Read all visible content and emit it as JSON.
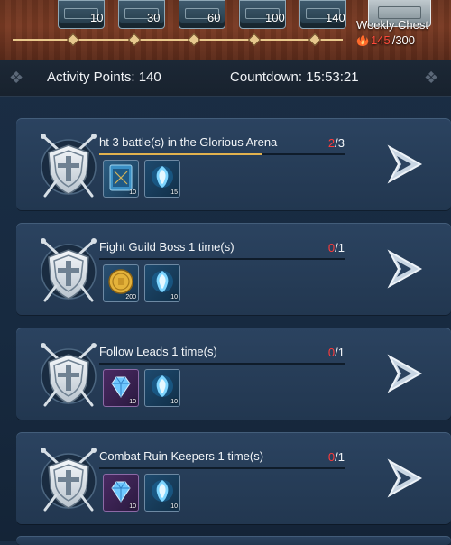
{
  "weekly_chest": {
    "label": "Weekly Chest",
    "current": "145",
    "max": "/300",
    "milestones": [
      "10",
      "30",
      "60",
      "100",
      "140"
    ]
  },
  "stats": {
    "activity_label": "Activity Points: 140",
    "countdown_label": "Countdown: 15:53:21"
  },
  "tasks": [
    {
      "title": "ht 3 battle(s) in the Glorious Arena",
      "progress_current": "2",
      "progress_total": "/3",
      "progress_fraction": 0.667,
      "rewards": [
        {
          "icon": "book-icon",
          "qty": "10"
        },
        {
          "icon": "spirit-orb-icon",
          "qty": "15"
        }
      ]
    },
    {
      "title": "Fight Guild Boss 1 time(s)",
      "progress_current": "0",
      "progress_total": "/1",
      "progress_fraction": 0,
      "rewards": [
        {
          "icon": "gold-coin-icon",
          "qty": "200"
        },
        {
          "icon": "spirit-orb-icon",
          "qty": "10"
        }
      ]
    },
    {
      "title": "Follow Leads 1 time(s)",
      "progress_current": "0",
      "progress_total": "/1",
      "progress_fraction": 0,
      "rewards": [
        {
          "icon": "diamond-icon",
          "qty": "10"
        },
        {
          "icon": "spirit-orb-icon",
          "qty": "10"
        }
      ]
    },
    {
      "title": "Combat Ruin Keepers 1 time(s)",
      "progress_current": "0",
      "progress_total": "/1",
      "progress_fraction": 0,
      "rewards": [
        {
          "icon": "diamond-icon",
          "qty": "10"
        },
        {
          "icon": "spirit-orb-icon",
          "qty": "10"
        }
      ]
    }
  ],
  "colors": {
    "progress_current": "#ff3b3b",
    "progress_bar": "#e2b24e",
    "header_brown": "#6b3420",
    "panel_blue": "#2b4360"
  }
}
